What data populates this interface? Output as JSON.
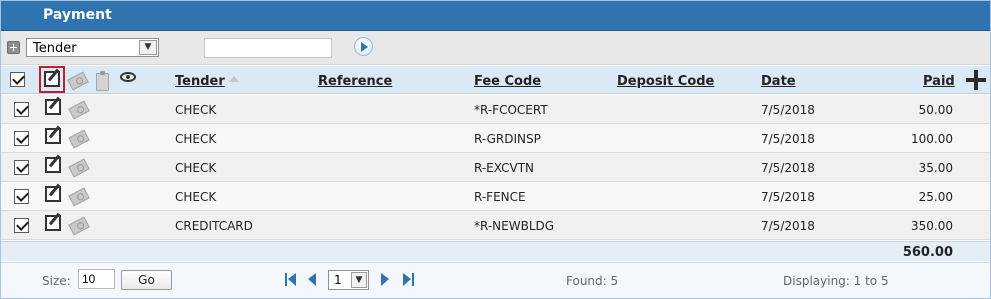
{
  "panel": {
    "title": "Payment"
  },
  "toolbar": {
    "filter_select_value": "Tender",
    "search_value": ""
  },
  "grid": {
    "columns": {
      "tender": "Tender",
      "reference": "Reference",
      "fee_code": "Fee Code",
      "deposit_code": "Deposit Code",
      "date": "Date",
      "paid": "Paid"
    },
    "rows": [
      {
        "tender": "CHECK",
        "reference": "",
        "fee_code": "*R-FCOCERT",
        "deposit_code": "",
        "date": "7/5/2018",
        "paid": "50.00"
      },
      {
        "tender": "CHECK",
        "reference": "",
        "fee_code": "R-GRDINSP",
        "deposit_code": "",
        "date": "7/5/2018",
        "paid": "100.00"
      },
      {
        "tender": "CHECK",
        "reference": "",
        "fee_code": "R-EXCVTN",
        "deposit_code": "",
        "date": "7/5/2018",
        "paid": "35.00"
      },
      {
        "tender": "CHECK",
        "reference": "",
        "fee_code": "R-FENCE",
        "deposit_code": "",
        "date": "7/5/2018",
        "paid": "25.00"
      },
      {
        "tender": "CREDITCARD",
        "reference": "",
        "fee_code": "*R-NEWBLDG",
        "deposit_code": "",
        "date": "7/5/2018",
        "paid": "350.00"
      }
    ],
    "total_paid": "560.00"
  },
  "footer": {
    "size_label": "Size:",
    "size_value": "10",
    "go_label": "Go",
    "page_value": "1",
    "found_text": "Found: 5",
    "displaying_text": "Displaying: 1 to 5"
  },
  "icons": {
    "expand": "plus-square-icon",
    "go": "arrow-right-circle-icon",
    "edit": "edit-icon",
    "money": "money-icon",
    "clipboard": "clipboard-icon",
    "view": "eye-icon",
    "add": "plus-icon"
  },
  "colors": {
    "header_bg": "#2f74b1",
    "grid_header_bg": "#dbe8f5",
    "highlight_border": "#c0202a"
  }
}
